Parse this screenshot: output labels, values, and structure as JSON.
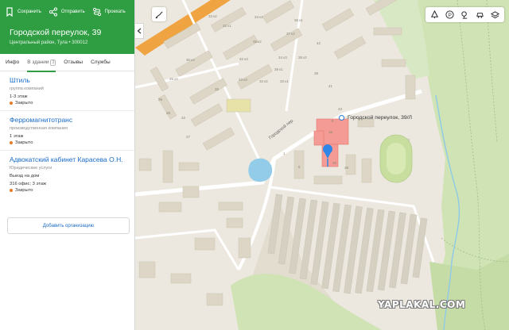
{
  "header": {
    "actions": [
      {
        "label": "Сохранить",
        "icon": "bookmark-icon"
      },
      {
        "label": "Отправить",
        "icon": "share-icon"
      },
      {
        "label": "Проехать",
        "icon": "route-icon"
      }
    ],
    "title": "Городской переулок, 39",
    "subtitle": "Центральный район, Тула • 300012"
  },
  "tabs": [
    {
      "label": "Инфо"
    },
    {
      "label": "В здании",
      "count": "3"
    },
    {
      "label": "Отзывы"
    },
    {
      "label": "Службы"
    }
  ],
  "organizations": [
    {
      "name": "Штиль",
      "category": "группа компаний",
      "detail": "1-3 этаж",
      "status": "Закрыто"
    },
    {
      "name": "Ферромагнитотранс",
      "category": "производственная компания",
      "detail": "1 этаж",
      "status": "Закрыто"
    },
    {
      "name": "Адвокатский кабинет Карасева О.Н.",
      "category": "Юридические услуги",
      "detail": "Выезд на дом",
      "detail2": "316 офис; 3 этаж",
      "status": "Закрыто"
    }
  ],
  "add_org_label": "Добавить организацию",
  "map": {
    "pin_label": "Городской переулок, 39/Л",
    "street_label": "Городской пер.",
    "watermark": "YAPLAKAL.COM",
    "building_numbers": [
      "33 к2",
      "34 к1",
      "32 к1",
      "36 к1",
      "35 к2",
      "37 к2",
      "42",
      "32 к3",
      "33 к3",
      "34 к3",
      "38 к2",
      "39 к1",
      "30 к4",
      "26 к2",
      "35",
      "38",
      "32 к2",
      "33 к1",
      "41",
      "29",
      "28",
      "32",
      "27",
      "43",
      "8",
      "16",
      "35",
      "39",
      "5",
      "1"
    ],
    "toolbar_icons": [
      "traffic-icon",
      "parking-icon",
      "panorama-icon",
      "car-icon",
      "layers-icon"
    ]
  },
  "colors": {
    "brand_green": "#2f9e43",
    "link_blue": "#1a6bc6",
    "status_orange": "#e57b2c",
    "highlight_building": "#f39b94"
  }
}
